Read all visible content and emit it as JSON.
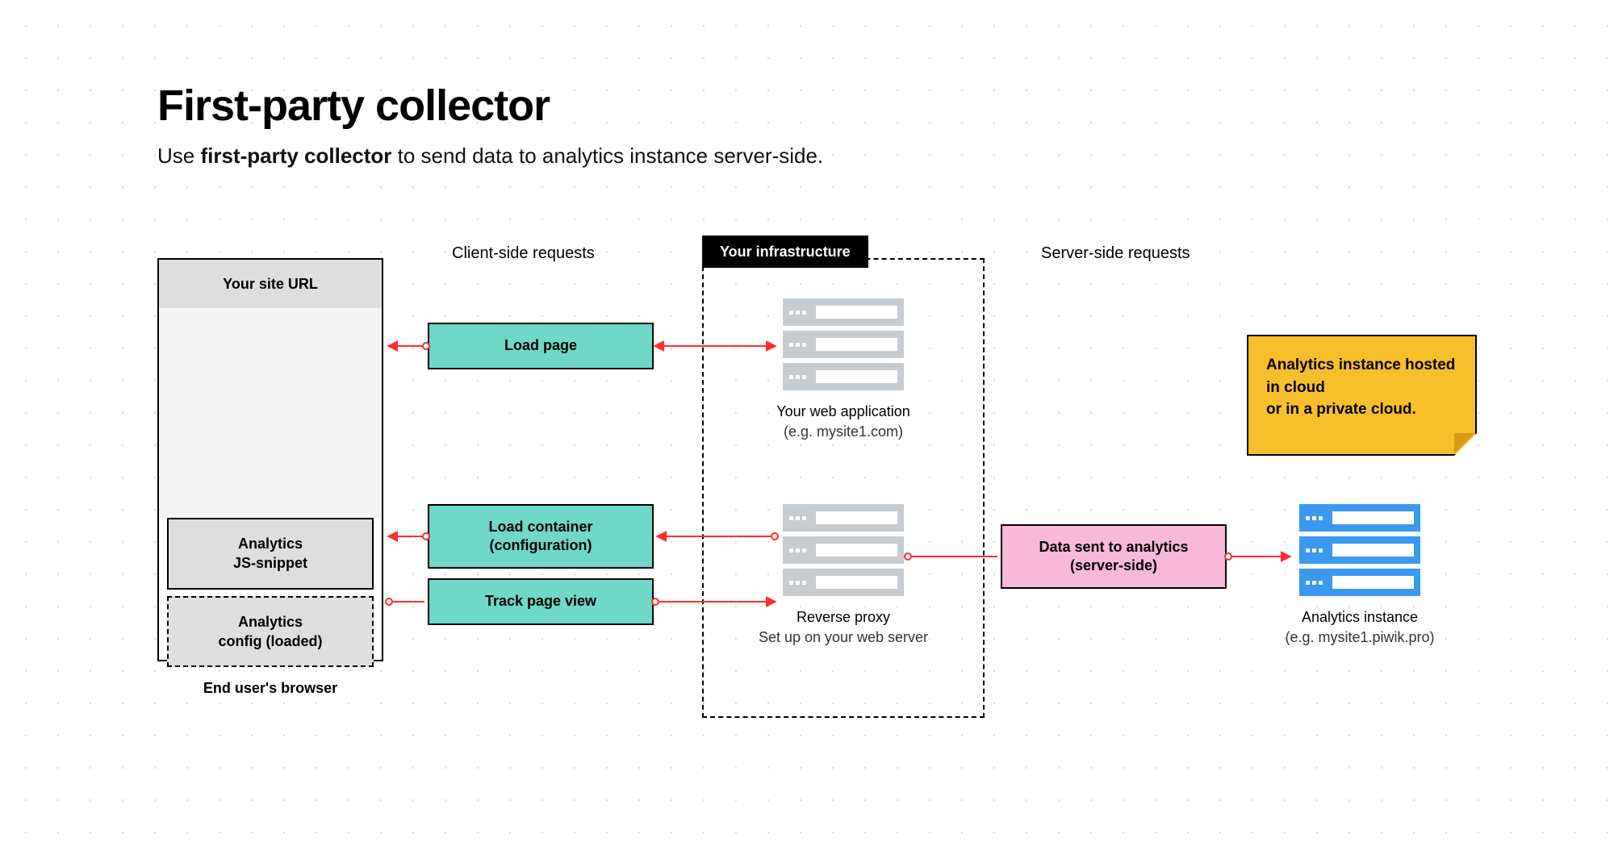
{
  "title": "First-party collector",
  "subtitle_prefix": "Use ",
  "subtitle_bold": "first-party collector",
  "subtitle_suffix": " to send data to analytics instance server-side.",
  "browser": {
    "url_label": "Your site URL",
    "snippet_box": "Analytics\nJS-snippet",
    "config_box": "Analytics\nconfig (loaded)",
    "caption": "End user's browser"
  },
  "sections": {
    "client_side": "Client-side requests",
    "server_side": "Server-side requests",
    "infra_tag": "Your infrastructure"
  },
  "flows": {
    "load_page": "Load page",
    "load_container": "Load container\n(configuration)",
    "track_page_view": "Track page view",
    "data_sent": "Data sent to analytics\n(server-side)"
  },
  "infra": {
    "webapp_title": "Your web application",
    "webapp_sub": "(e.g. mysite1.com)",
    "proxy_title": "Reverse proxy",
    "proxy_sub": "Set up on your web server"
  },
  "analytics": {
    "title": "Analytics instance",
    "sub": "(e.g. mysite1.piwik.pro)"
  },
  "sticky": "Analytics instance hosted in cloud\nor in a private cloud."
}
